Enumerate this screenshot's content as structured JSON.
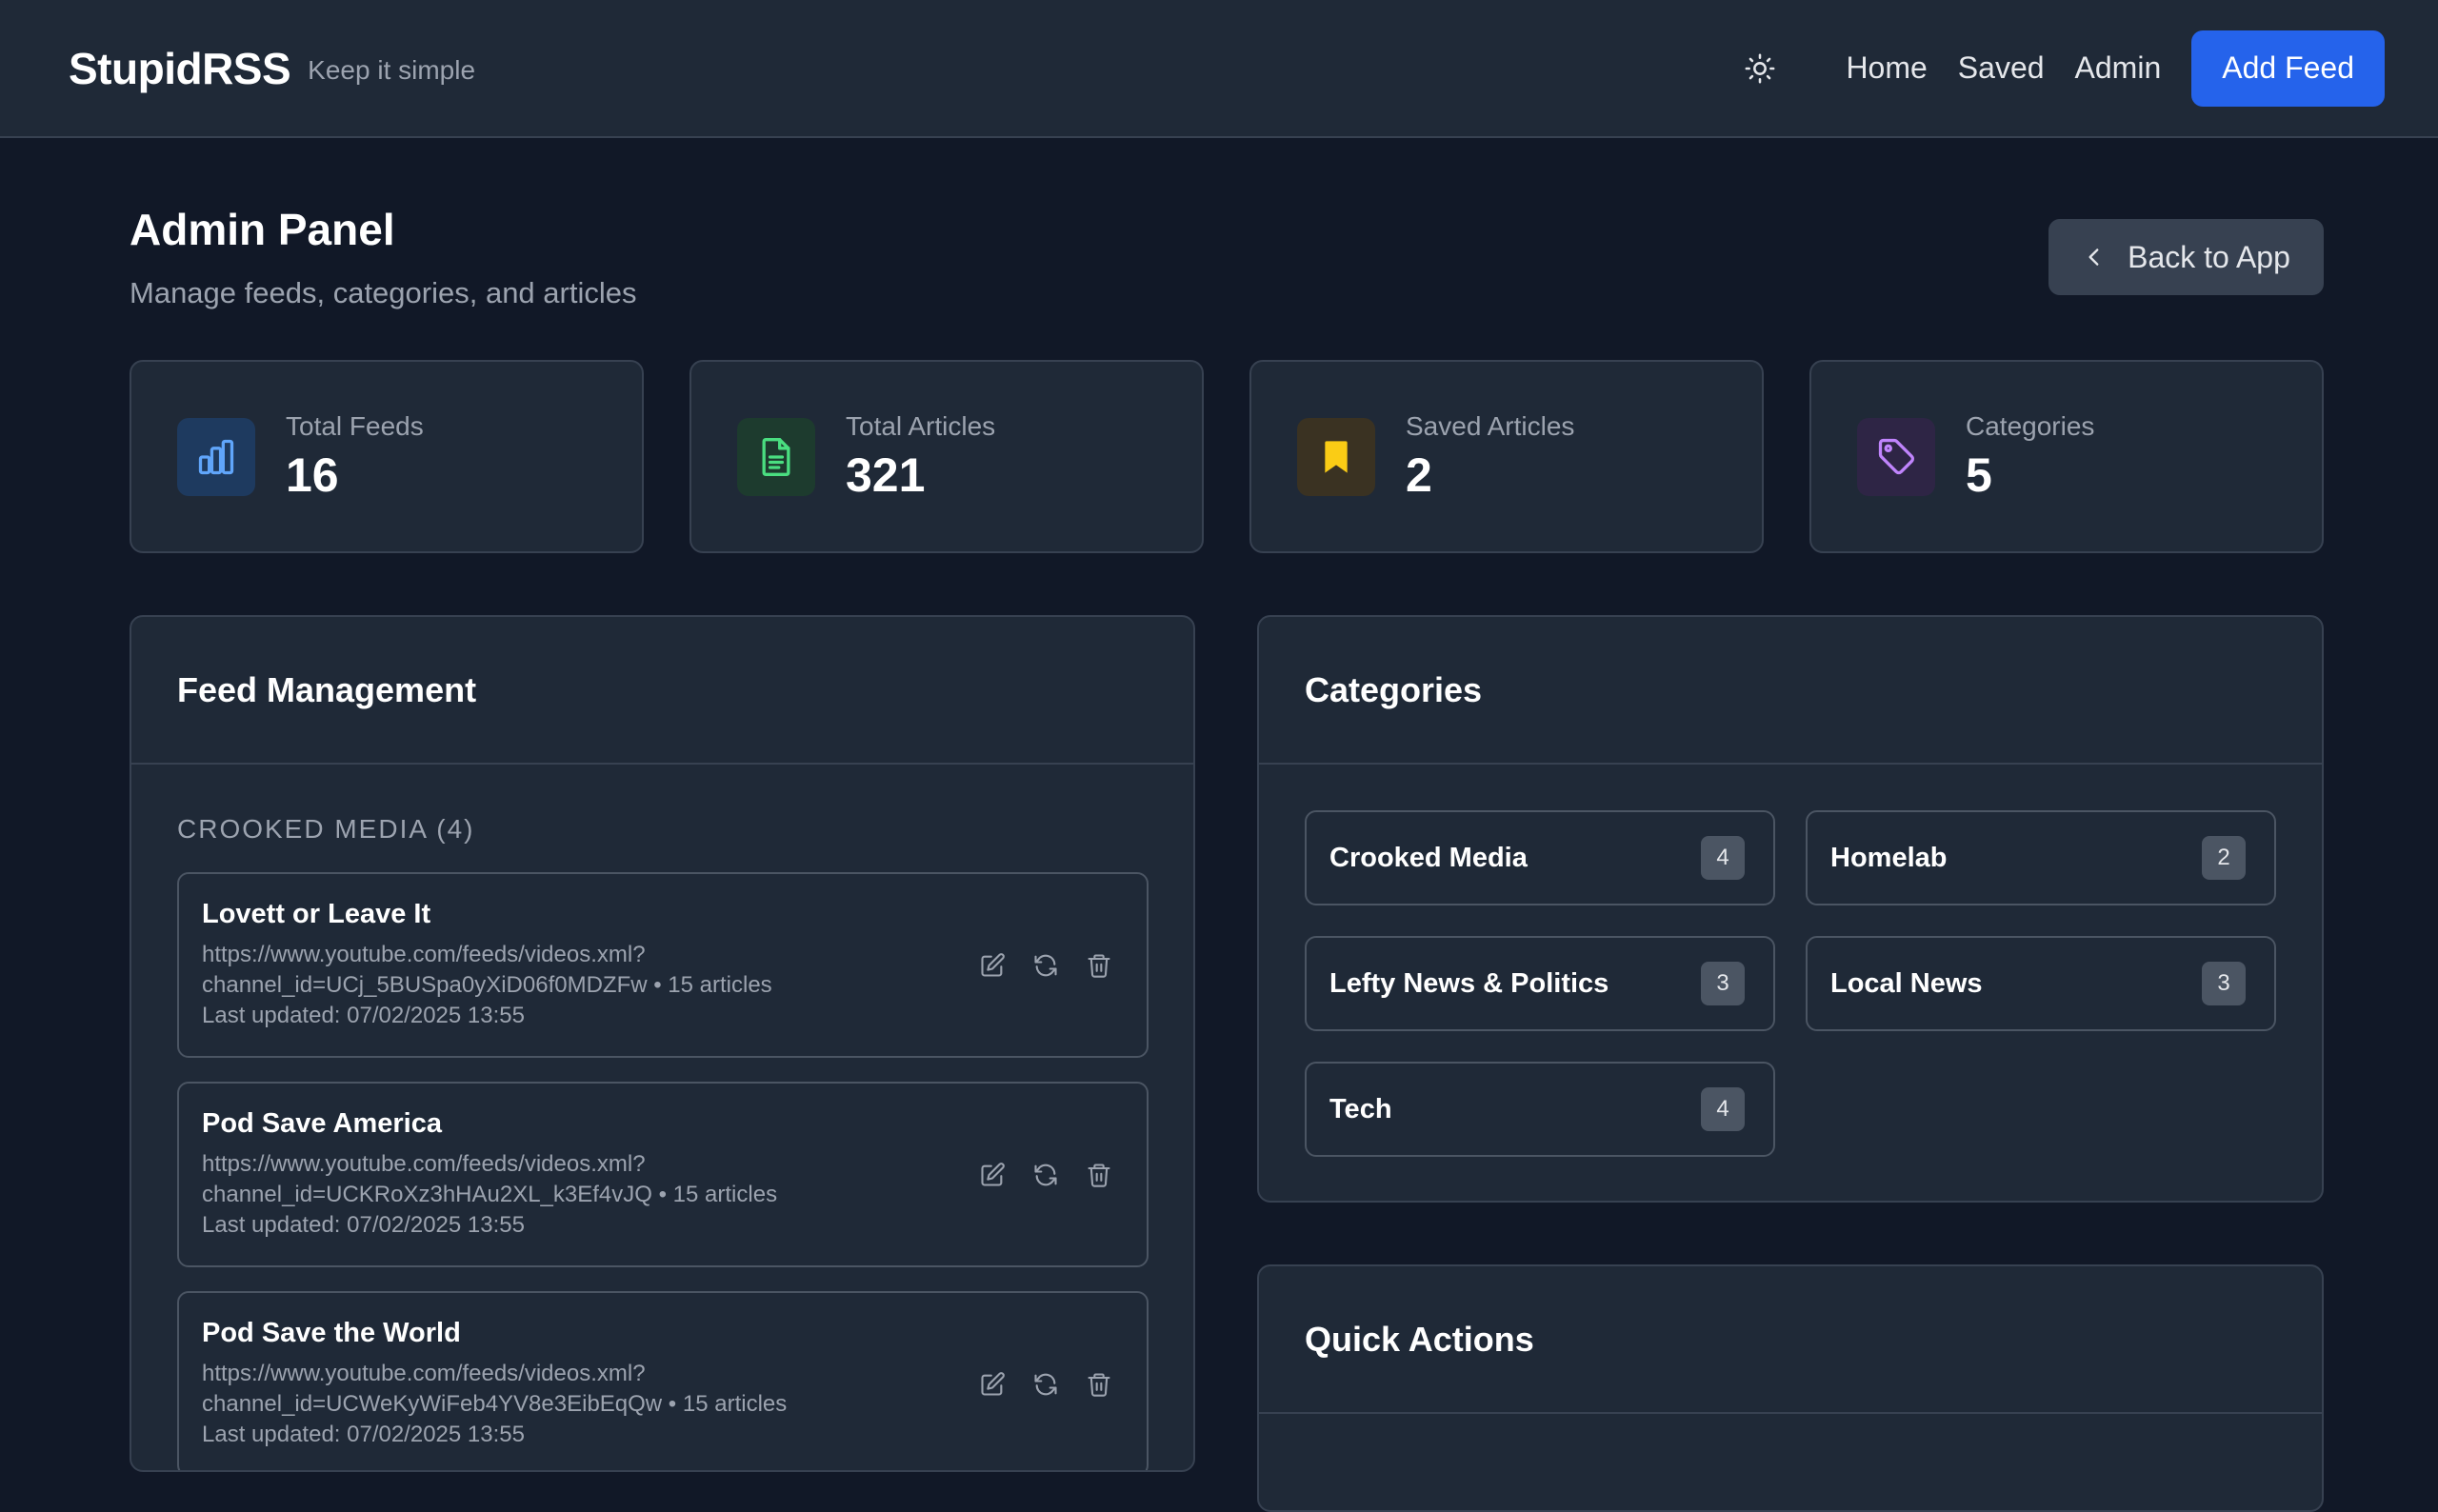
{
  "header": {
    "brand": "StupidRSS",
    "tagline": "Keep it simple",
    "theme_icon": "sun-icon",
    "nav": [
      "Home",
      "Saved",
      "Admin"
    ],
    "add_feed_label": "Add Feed",
    "accent_color": "#2563eb"
  },
  "page": {
    "title": "Admin Panel",
    "subtitle": "Manage feeds, categories, and articles",
    "back_label": "Back to App"
  },
  "stats": [
    {
      "label": "Total Feeds",
      "value": "16",
      "icon": "bar-chart-icon",
      "color": "#60a5fa"
    },
    {
      "label": "Total Articles",
      "value": "321",
      "icon": "document-icon",
      "color": "#4ade80"
    },
    {
      "label": "Saved Articles",
      "value": "2",
      "icon": "bookmark-icon",
      "color": "#facc15"
    },
    {
      "label": "Categories",
      "value": "5",
      "icon": "tag-icon",
      "color": "#c084fc"
    }
  ],
  "feed_management": {
    "title": "Feed Management",
    "group": {
      "name": "CROOKED MEDIA",
      "count": "(4)"
    },
    "feeds": [
      {
        "name": "Lovett or Leave It",
        "url_line1": "https://www.youtube.com/feeds/videos.xml?",
        "url_line2": "channel_id=UCj_5BUSpa0yXiD06f0MDZFw • 15 articles",
        "updated": "Last updated: 07/02/2025 13:55"
      },
      {
        "name": "Pod Save America",
        "url_line1": "https://www.youtube.com/feeds/videos.xml?",
        "url_line2": "channel_id=UCKRoXz3hHAu2XL_k3Ef4vJQ • 15 articles",
        "updated": "Last updated: 07/02/2025 13:55"
      },
      {
        "name": "Pod Save the World",
        "url_line1": "https://www.youtube.com/feeds/videos.xml?",
        "url_line2": "channel_id=UCWeKyWiFeb4YV8e3EibEqQw • 15 articles",
        "updated": "Last updated: 07/02/2025 13:55"
      }
    ]
  },
  "categories": {
    "title": "Categories",
    "items": [
      {
        "name": "Crooked Media",
        "count": "4"
      },
      {
        "name": "Homelab",
        "count": "2"
      },
      {
        "name": "Lefty News & Politics",
        "count": "3"
      },
      {
        "name": "Local News",
        "count": "3"
      },
      {
        "name": "Tech",
        "count": "4"
      }
    ]
  },
  "quick_actions": {
    "title": "Quick Actions"
  }
}
